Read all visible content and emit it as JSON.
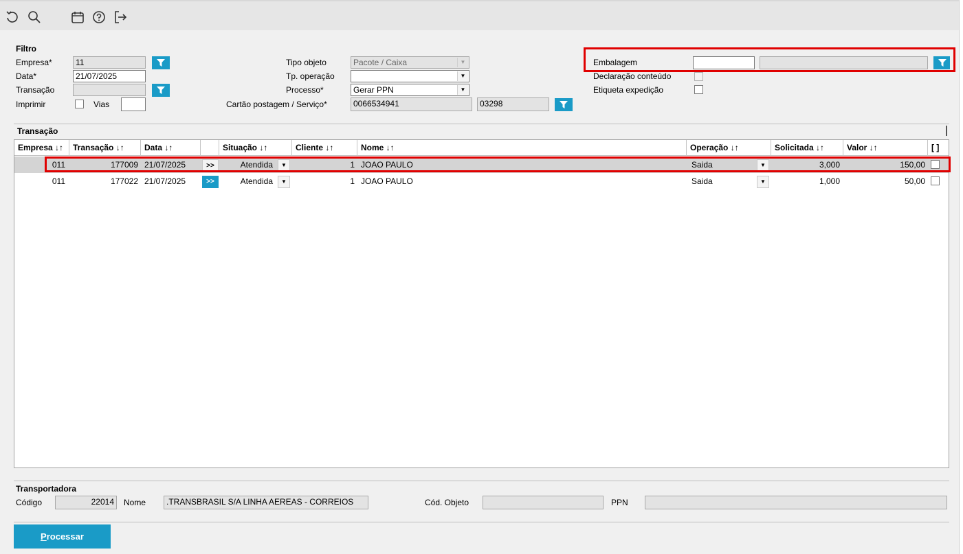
{
  "toolbar": {
    "icons": [
      "refresh-icon",
      "search-icon",
      "calendar-icon",
      "help-icon",
      "exit-icon"
    ]
  },
  "filter": {
    "title": "Filtro",
    "empresa_label": "Empresa*",
    "empresa_value": "11",
    "data_label": "Data*",
    "data_value": "21/07/2025",
    "transacao_label": "Transação",
    "transacao_value": "",
    "imprimir_label": "Imprimir",
    "vias_label": "Vias",
    "vias_value": "",
    "tipo_objeto_label": "Tipo objeto",
    "tipo_objeto_value": "Pacote / Caixa",
    "tp_operacao_label": "Tp. operação",
    "tp_operacao_value": "",
    "processo_label": "Processo*",
    "processo_value": "Gerar PPN",
    "cartao_label": "Cartão postagem / Serviço*",
    "cartao_value": "0066534941",
    "servico_value": "03298",
    "embalagem_label": "Embalagem",
    "embalagem_code": "",
    "embalagem_desc": "",
    "declaracao_label": "Declaração conteúdo",
    "etiqueta_label": "Etiqueta expedição"
  },
  "transacoes": {
    "title": "Transação",
    "columns": [
      "Empresa ↓↑",
      "Transação ↓↑",
      "Data ↓↑",
      "",
      "Situação ↓↑",
      "Cliente ↓↑",
      "Nome ↓↑",
      "Operação ↓↑",
      "Solicitada ↓↑",
      "Valor ↓↑",
      "[ ]"
    ],
    "rows": [
      {
        "empresa": "011",
        "transacao": "177009",
        "data": "21/07/2025",
        "btn": ">>",
        "situacao": "Atendida",
        "cliente": "1",
        "nome": "JOAO PAULO",
        "operacao": "Saida",
        "solicitada": "3,000",
        "valor": "150,00",
        "selected": true
      },
      {
        "empresa": "011",
        "transacao": "177022",
        "data": "21/07/2025",
        "btn": ">>",
        "situacao": "Atendida",
        "cliente": "1",
        "nome": "JOAO PAULO",
        "operacao": "Saida",
        "solicitada": "1,000",
        "valor": "50,00",
        "selected": false
      }
    ]
  },
  "transportadora": {
    "title": "Transportadora",
    "codigo_label": "Código",
    "codigo_value": "22014",
    "nome_label": "Nome",
    "nome_value": ".TRANSBRASIL S/A LINHA AEREAS - CORREIOS",
    "cod_objeto_label": "Cód. Objeto",
    "cod_objeto_value": "",
    "ppn_label": "PPN",
    "ppn_value": ""
  },
  "actions": {
    "processar_first": "P",
    "processar_rest": "rocessar"
  },
  "colors": {
    "accent": "#1a9bc7",
    "highlight": "#e00000",
    "selected_row": "#d4d4d4"
  }
}
